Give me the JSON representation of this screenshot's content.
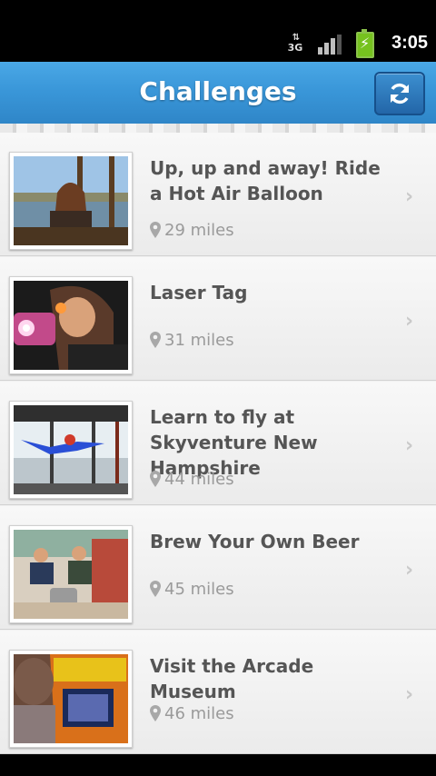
{
  "status_bar": {
    "network": "3G",
    "time": "3:05",
    "signal_bars": 3,
    "battery_state": "charging"
  },
  "header": {
    "title": "Challenges",
    "refresh_icon": "refresh-icon"
  },
  "challenges": [
    {
      "title": "Up, up and away! Ride a Hot Air Balloon",
      "distance": "29 miles"
    },
    {
      "title": "Laser Tag",
      "distance": "31 miles"
    },
    {
      "title": "Learn to fly at Skyventure New Hampshire",
      "distance": "44 miles"
    },
    {
      "title": "Brew Your Own Beer",
      "distance": "45 miles"
    },
    {
      "title": "Visit the Arcade Museum",
      "distance": "46 miles"
    }
  ],
  "icons": {
    "pin": "map-pin-icon",
    "chevron": "chevron-right-icon"
  },
  "colors": {
    "header_blue": "#3a97d9",
    "title_text": "#555555",
    "distance_text": "#9a9a9a"
  }
}
